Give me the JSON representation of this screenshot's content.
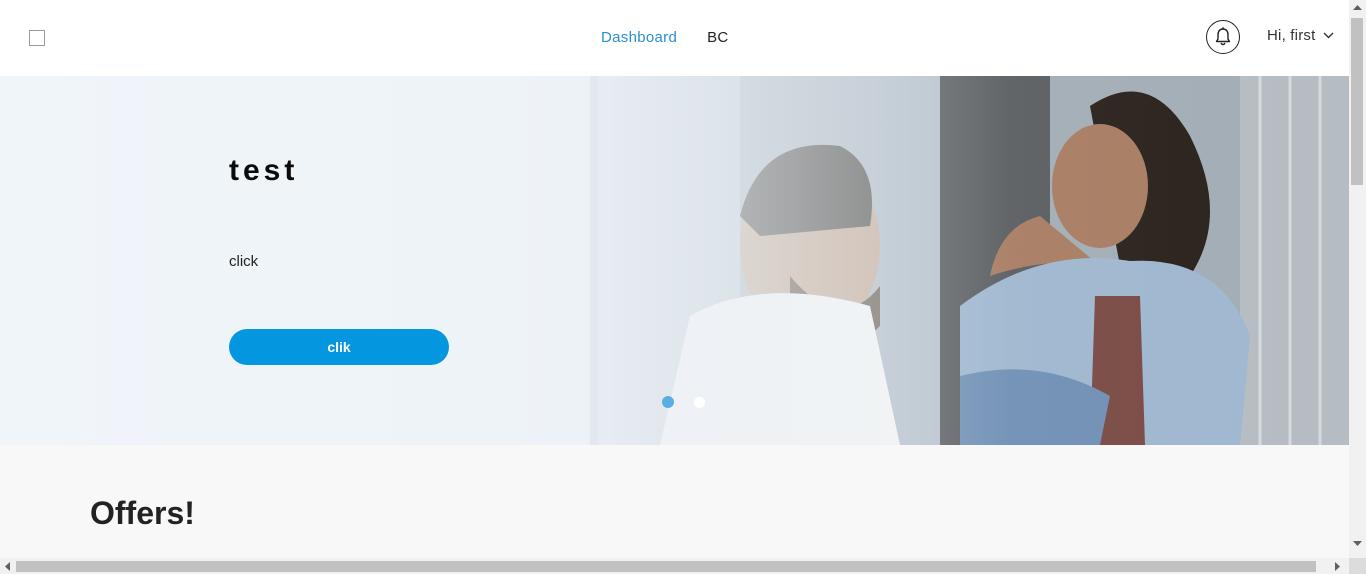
{
  "header": {
    "nav": [
      {
        "label": "Dashboard",
        "active": true
      },
      {
        "label": "BC",
        "active": false
      }
    ],
    "user_greeting": "Hi, first"
  },
  "hero": {
    "title": "test",
    "subtitle": "click",
    "button_label": "clik",
    "slides": 2,
    "active_slide": 1
  },
  "offers": {
    "title": "Offers!"
  },
  "icons": {
    "logo": "logo-placeholder-icon",
    "notifications": "bell-icon",
    "user_menu": "chevron-down-icon"
  },
  "colors": {
    "accent": "#0596e0",
    "nav_active": "#2b8fd0",
    "dot_active": "#5aaee3"
  }
}
